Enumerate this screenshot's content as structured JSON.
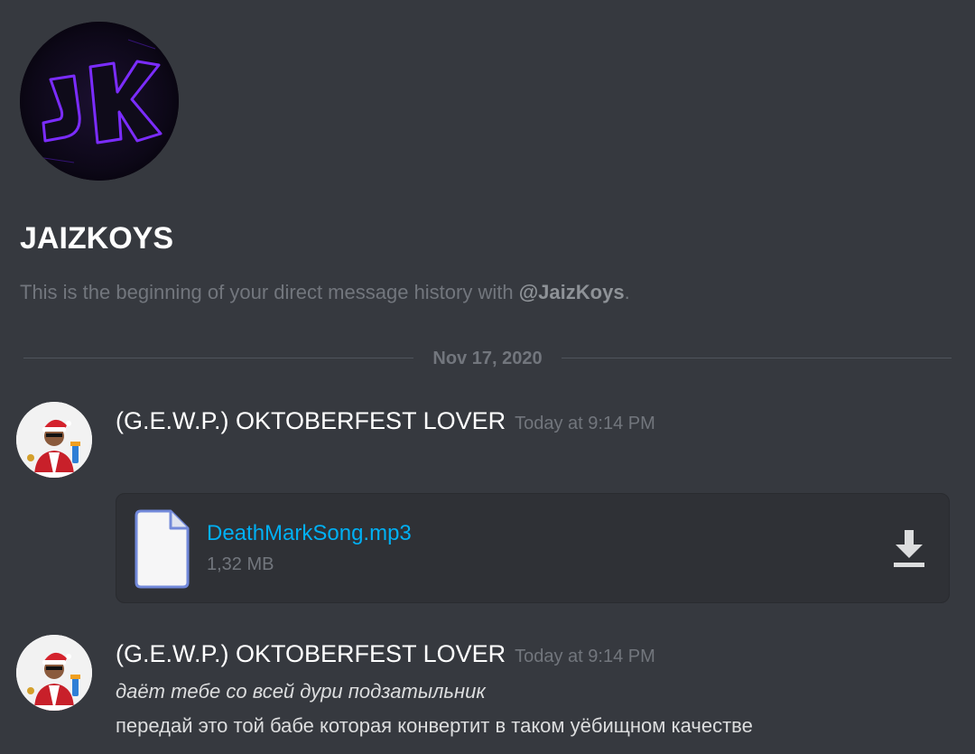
{
  "dm": {
    "name": "JAIZKOYS",
    "intro_prefix": "This is the beginning of your direct message history with ",
    "intro_mention": "@JaizKoys",
    "intro_suffix": "."
  },
  "divider": {
    "date": "Nov 17, 2020"
  },
  "messages": [
    {
      "author": "(G.E.W.P.) OKTOBERFEST LOVER",
      "timestamp": "Today at 9:14 PM",
      "attachment": {
        "file_name": "DeathMarkSong.mp3",
        "file_size": "1,32 MB"
      }
    },
    {
      "author": "(G.E.W.P.) OKTOBERFEST LOVER",
      "timestamp": "Today at 9:14 PM",
      "lines": [
        "даёт тебе со всей дури подзатыльник",
        "передай это той бабе которая конвертит в таком уёбищном качестве"
      ]
    }
  ],
  "icons": {
    "file": "file-icon",
    "download": "download-icon"
  },
  "colors": {
    "background": "#36393f",
    "attachment_bg": "#2f3136",
    "link": "#00b0f4",
    "muted": "#72767d",
    "avatar_glow": "#7b2cff"
  }
}
